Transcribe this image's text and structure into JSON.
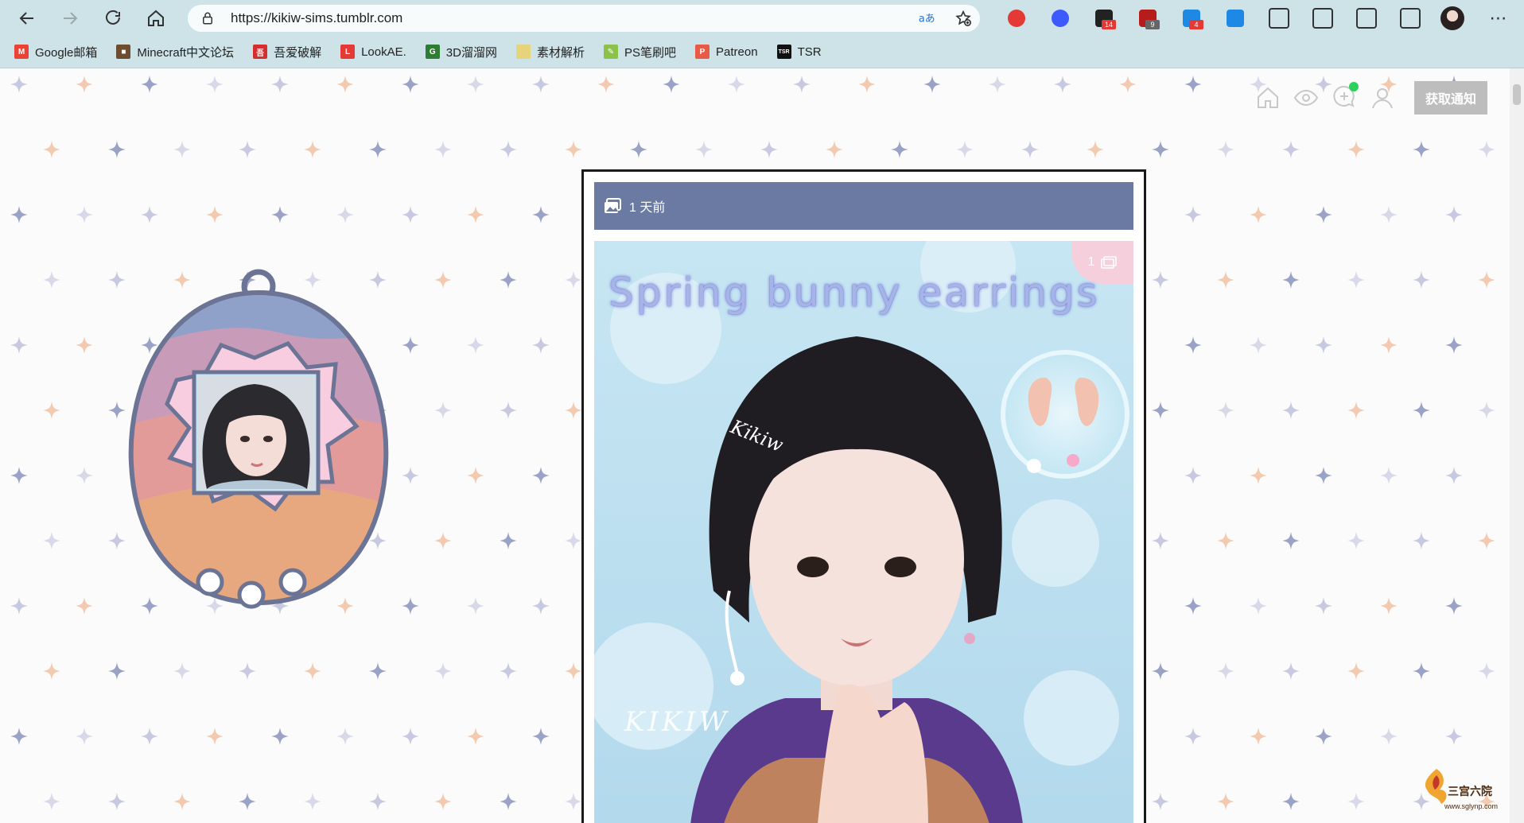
{
  "browser": {
    "url": "https://kikiw-sims.tumblr.com",
    "extensions": [
      {
        "icon": "abp-icon",
        "badge": "",
        "color": "#e53935"
      },
      {
        "icon": "color-extension-icon",
        "badge": "",
        "color": "#3d5afe"
      },
      {
        "icon": "message-extension-icon",
        "badge": "14",
        "color": "#222222"
      },
      {
        "icon": "ublock-icon",
        "badge": "9",
        "color": "#b71c1c"
      },
      {
        "icon": "apps-extension-icon",
        "badge": "4",
        "color": "#1e88e5"
      },
      {
        "icon": "crop-extension-icon",
        "badge": "",
        "color": "#1e88e5"
      },
      {
        "icon": "puzzle-icon",
        "badge": "",
        "color": "#333333"
      },
      {
        "icon": "favorites-icon",
        "badge": "",
        "color": "#333333"
      },
      {
        "icon": "collections-icon",
        "badge": "",
        "color": "#333333"
      },
      {
        "icon": "download-icon",
        "badge": "",
        "color": "#333333"
      }
    ]
  },
  "bookmarks": [
    {
      "label": "Google邮箱",
      "icon": "gmail-icon",
      "color": "#ea4335",
      "glyph": "M"
    },
    {
      "label": "Minecraft中文论坛",
      "icon": "minecraft-icon",
      "color": "#6d4c2f",
      "glyph": "■"
    },
    {
      "label": "吾爱破解",
      "icon": "52pojie-icon",
      "color": "#d32f2f",
      "glyph": "吾"
    },
    {
      "label": "LookAE.",
      "icon": "lookae-icon",
      "color": "#e53935",
      "glyph": "L"
    },
    {
      "label": "3D溜溜网",
      "icon": "3d66-icon",
      "color": "#2e7d32",
      "glyph": "G"
    },
    {
      "label": "素材解析",
      "icon": "folder-icon",
      "color": "#e7d37a",
      "glyph": ""
    },
    {
      "label": "PS笔刷吧",
      "icon": "brush-icon",
      "color": "#8bc34a",
      "glyph": "✎"
    },
    {
      "label": "Patreon",
      "icon": "patreon-icon",
      "color": "#e85b46",
      "glyph": "P"
    },
    {
      "label": "TSR",
      "icon": "tsr-icon",
      "color": "#111111",
      "glyph": "TSR"
    }
  ],
  "blog": {
    "notify_label": "获取通知",
    "post": {
      "time": "1 天前",
      "image_count": "1",
      "title": "Spring bunny earrings",
      "signature": "KIKIW"
    }
  },
  "watermark": {
    "cn": "三宫六院",
    "en": "www.sglynp.com"
  }
}
